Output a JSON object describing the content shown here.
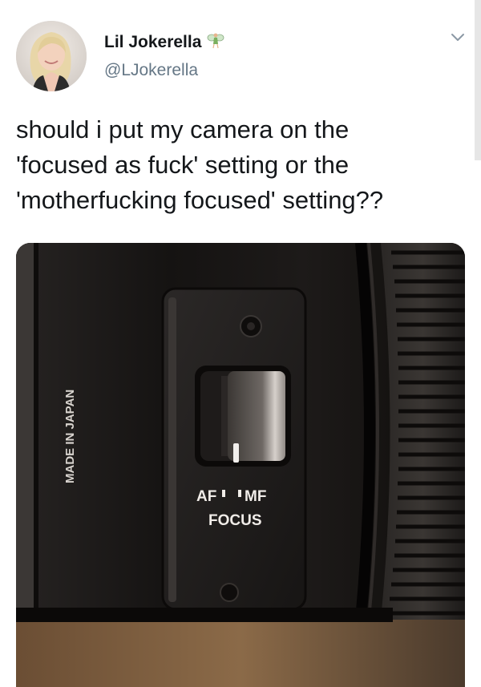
{
  "author": {
    "display_name": "Lil Jokerella",
    "handle": "@LJokerella",
    "name_emoji_icon": "fairy-icon"
  },
  "tweet": {
    "text": "should i put my camera on the\n'focused as fuck' setting or the\n'motherfucking focused' setting??"
  },
  "media": {
    "description_icon": "camera-lens-photo",
    "lens_side_text": "MADE IN JAPAN",
    "switch_labels": {
      "af": "AF",
      "mf": "MF",
      "focus": "FOCUS"
    }
  },
  "menu": {
    "icon": "chevron-down-icon"
  }
}
